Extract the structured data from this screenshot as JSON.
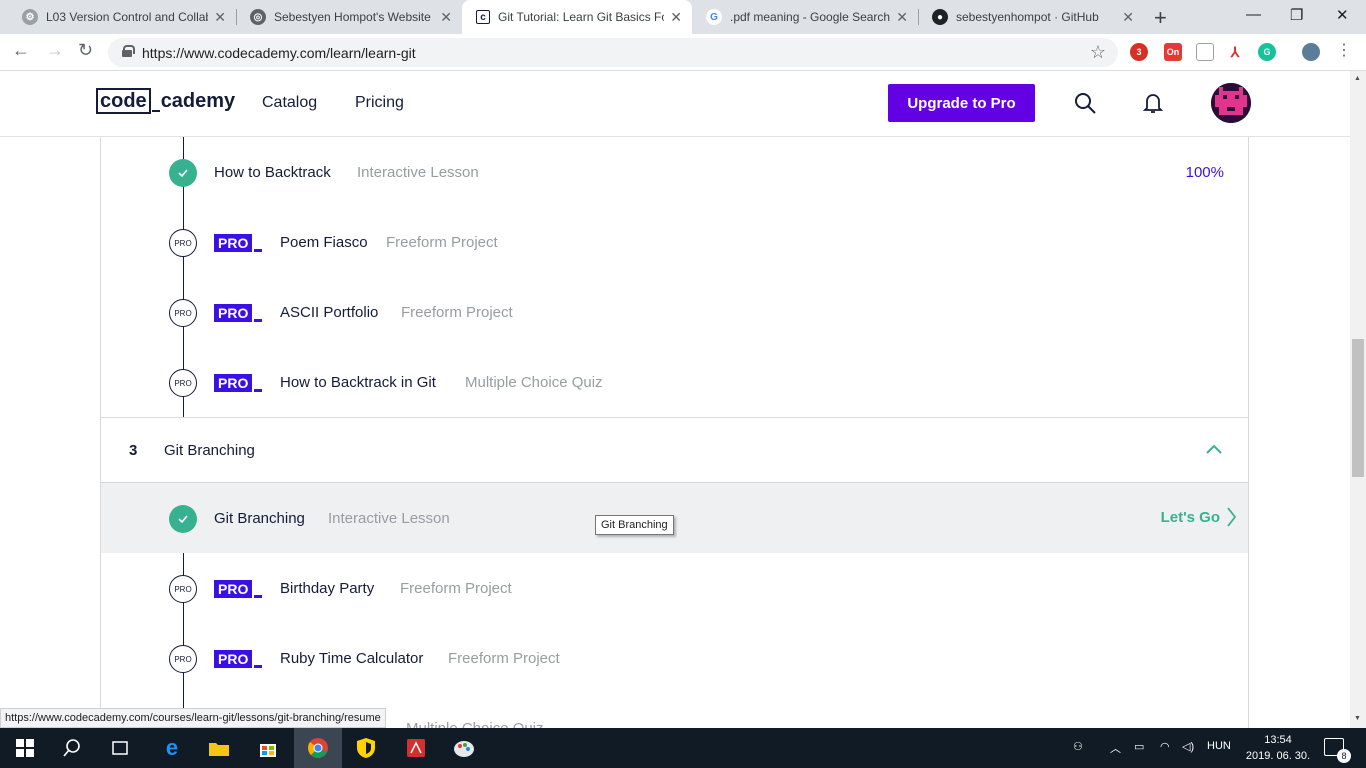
{
  "browser": {
    "tabs": [
      {
        "title": "L03 Version Control and Collab",
        "icon": "settings-icon"
      },
      {
        "title": "Sebestyen Hompot's Website",
        "icon": "globe-icon"
      },
      {
        "title": "Git Tutorial: Learn Git Basics Fo",
        "icon": "codecademy-icon"
      },
      {
        "title": ".pdf meaning - Google Search",
        "icon": "google-icon"
      },
      {
        "title": "sebestyenhompot · GitHub",
        "icon": "github-icon"
      }
    ],
    "new_tab": "+",
    "url": "https://www.codecademy.com/learn/learn-git",
    "extension_badge_count": "3",
    "extension_on_label": "On"
  },
  "header": {
    "logo_left": "code",
    "logo_right": "cademy",
    "nav": [
      "Catalog",
      "Pricing"
    ],
    "upgrade_label": "Upgrade to Pro"
  },
  "syllabus": {
    "top_items": [
      {
        "title": "How to Backtrack",
        "type": "Interactive Lesson",
        "status": "complete",
        "progress": "100%"
      },
      {
        "title": "Poem Fiasco",
        "type": "Freeform Project",
        "status": "pro"
      },
      {
        "title": "ASCII Portfolio",
        "type": "Freeform Project",
        "status": "pro"
      },
      {
        "title": "How to Backtrack in Git",
        "type": "Multiple Choice Quiz",
        "status": "pro"
      }
    ],
    "pro_badge": "PRO",
    "pro_circle_label": "PRO",
    "section": {
      "number": "3",
      "title": "Git Branching"
    },
    "section_items": [
      {
        "title": "Git Branching",
        "type": "Interactive Lesson",
        "status": "complete",
        "action": "Let's Go"
      },
      {
        "title": "Birthday Party",
        "type": "Freeform Project",
        "status": "pro"
      },
      {
        "title": "Ruby Time Calculator",
        "type": "Freeform Project",
        "status": "pro"
      },
      {
        "title": "",
        "type": "Multiple Choice Quiz",
        "status": "pro"
      }
    ],
    "tooltip": "Git Branching"
  },
  "status_url": "https://www.codecademy.com/courses/learn-git/lessons/git-branching/resume",
  "taskbar": {
    "language": "HUN",
    "time": "13:54",
    "date": "2019. 06. 30.",
    "notification_count": "8"
  },
  "colors": {
    "brand_purple": "#6400e4",
    "pro_blue": "#3a10e5",
    "complete_green": "#37b28f",
    "navy": "#141c3a"
  }
}
